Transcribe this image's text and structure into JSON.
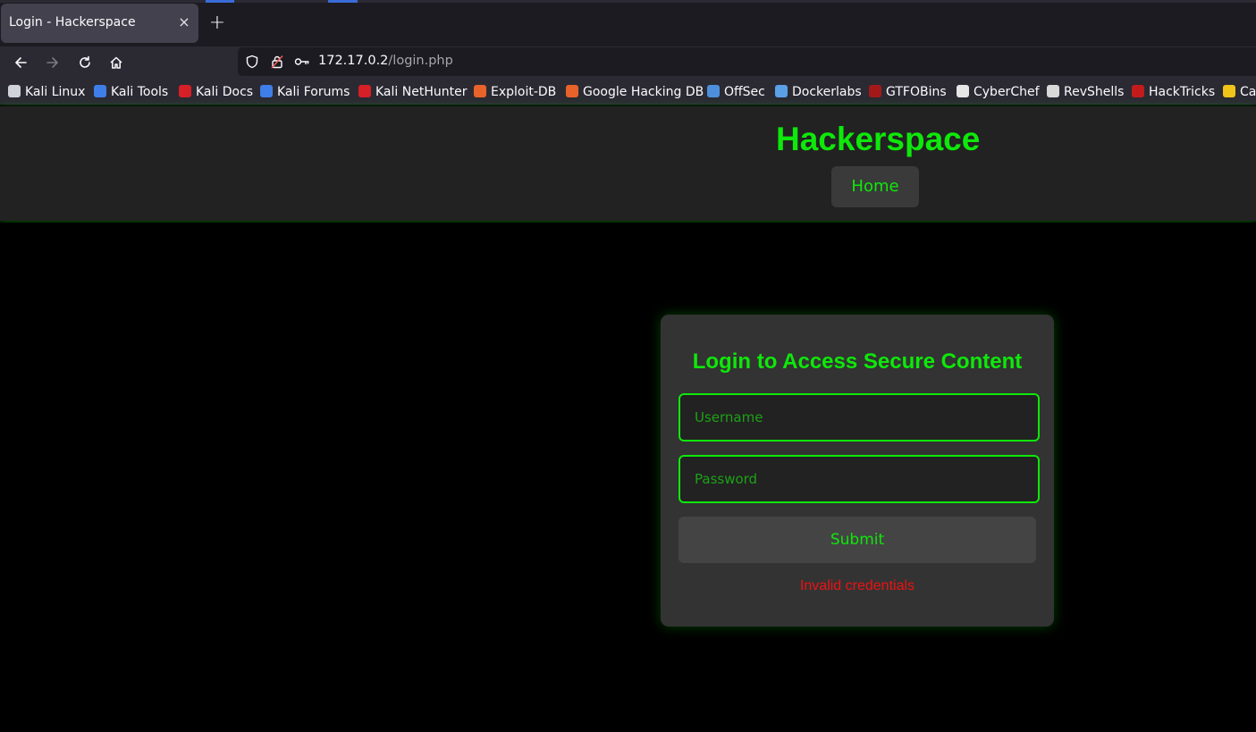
{
  "browser": {
    "tab": {
      "title": "Login - Hackerspace",
      "close_glyph": "×"
    },
    "new_tab_glyph": "+",
    "url": {
      "host": "172.17.0.2",
      "path": "/login.php"
    },
    "bookmarks": [
      {
        "label": "Kali Linux",
        "icon": "kali-dragon-icon",
        "color": "#cfd2d8"
      },
      {
        "label": "Kali Tools",
        "icon": "kali-tools-icon",
        "color": "#3f7ee8"
      },
      {
        "label": "Kali Docs",
        "icon": "kali-docs-icon",
        "color": "#d61f26"
      },
      {
        "label": "Kali Forums",
        "icon": "kali-forums-icon",
        "color": "#3f7ee8"
      },
      {
        "label": "Kali NetHunter",
        "icon": "nethunter-icon",
        "color": "#d61f26"
      },
      {
        "label": "Exploit-DB",
        "icon": "exploit-db-icon",
        "color": "#e8632a"
      },
      {
        "label": "Google Hacking DB",
        "icon": "ghdb-icon",
        "color": "#e8632a"
      },
      {
        "label": "OffSec",
        "icon": "offsec-icon",
        "color": "#4d8fdc"
      },
      {
        "label": "Dockerlabs",
        "icon": "dockerlabs-icon",
        "color": "#5aa0e6"
      },
      {
        "label": "GTFOBins",
        "icon": "gtfobins-icon",
        "color": "#a31919"
      },
      {
        "label": "CyberChef",
        "icon": "cyberchef-icon",
        "color": "#e6e6e6"
      },
      {
        "label": "RevShells",
        "icon": "revshells-icon",
        "color": "#d9d9d9"
      },
      {
        "label": "HackTricks",
        "icon": "hacktricks-icon",
        "color": "#c21b1b"
      },
      {
        "label": "Ca",
        "icon": "bookmark-icon",
        "color": "#f0c419"
      }
    ]
  },
  "site": {
    "title": "Hackerspace",
    "nav_home": "Home",
    "accent": "#0ee80a"
  },
  "login": {
    "heading": "Login to Access Secure Content",
    "username_placeholder": "Username",
    "password_placeholder": "Password",
    "submit_label": "Submit",
    "error": "Invalid credentials",
    "error_color": "#ee1111"
  }
}
